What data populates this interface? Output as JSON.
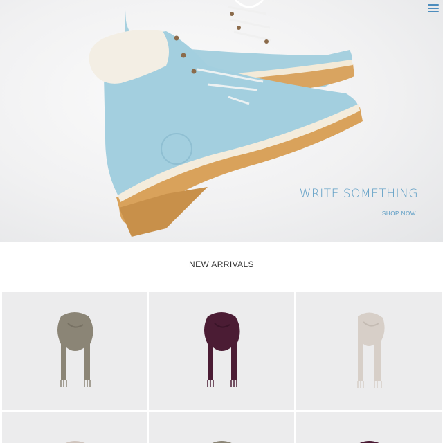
{
  "hero": {
    "title": "WRITE SOMETHING",
    "cta": "SHOP NOW",
    "menu_icon": "hamburger-menu-icon",
    "accent_color": "#5a9cc4"
  },
  "new_arrivals": {
    "heading": "NEW ARRIVALS",
    "products": [
      {
        "name": "olive-scarf",
        "color": "#8b8576"
      },
      {
        "name": "plum-scarf",
        "color": "#4b1c34"
      },
      {
        "name": "cream-scarf",
        "color": "#d7cfc8"
      },
      {
        "name": "taupe-scarf",
        "color": "#cfc4bd"
      },
      {
        "name": "olive-scarf",
        "color": "#8b8576"
      },
      {
        "name": "plum-scarf",
        "color": "#4b1c34"
      }
    ]
  }
}
